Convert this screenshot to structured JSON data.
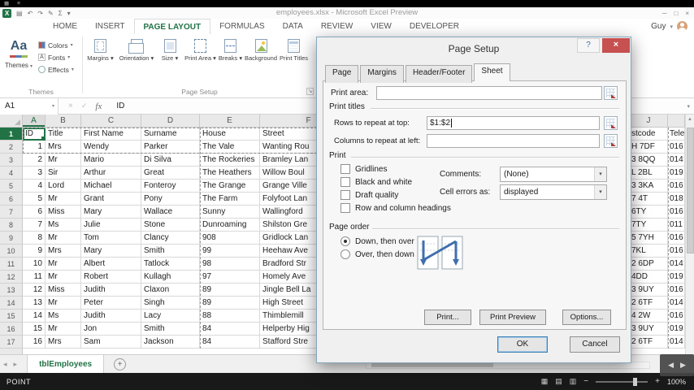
{
  "colors": {
    "accent": "#217346",
    "close_button": "#c75050"
  },
  "icons": {
    "grid": "▦",
    "menu": "≡",
    "excel_logo": "X",
    "save": "▤",
    "undo": "↶",
    "redo": "↷",
    "pencil": "✎",
    "autosum": "Σ",
    "chart": "▦",
    "qat_dropdown": "▾",
    "minimize": "─",
    "maximize": "□",
    "close": "×",
    "user_dropdown": "▾",
    "name_box_arrow": "▾",
    "cancel": "×",
    "enter": "✓",
    "fx": "fx",
    "formula_expand": "▾",
    "scroll_up": "▲",
    "tab_prev": "◂",
    "tab_next": "▸",
    "add_sheet": "+",
    "view_normal": "▦",
    "view_layout": "▤",
    "view_break": "▥",
    "zoom_out": "−",
    "zoom_in": "+",
    "nav_prev": "◀",
    "nav_next": "▶",
    "help": "?",
    "launcher": "↘",
    "combo_arrow": "▾"
  },
  "title_bar": {
    "title": "employees.xlsx - Microsoft Excel Preview"
  },
  "ribbon": {
    "tabs": [
      "HOME",
      "INSERT",
      "PAGE LAYOUT",
      "FORMULAS",
      "DATA",
      "REVIEW",
      "VIEW",
      "DEVELOPER"
    ],
    "active": "PAGE LAYOUT",
    "user_name": "Guy",
    "themes_group": {
      "label": "Themes",
      "big_button": "Themes",
      "icon_text": "Aa",
      "items": [
        "Colors",
        "Fonts",
        "Effects"
      ]
    },
    "pagesetup_group": {
      "label": "Page Setup",
      "buttons": [
        "Margins",
        "Orientation",
        "Size",
        "Print Area",
        "Breaks",
        "Background",
        "Print Titles"
      ]
    }
  },
  "formula_bar": {
    "name_box": "A1",
    "value": "ID"
  },
  "sheet": {
    "columns": [
      "A",
      "B",
      "C",
      "D",
      "E",
      "F"
    ],
    "rows": [
      [
        "ID",
        "Title",
        "First Name",
        "Surname",
        "House",
        "Street"
      ],
      [
        "1",
        "Mrs",
        "Wendy",
        "Parker",
        "The Vale",
        "Wanting Rou"
      ],
      [
        "2",
        "Mr",
        "Mario",
        "Di Silva",
        "The Rockeries",
        "Bramley Lan"
      ],
      [
        "3",
        "Sir",
        "Arthur",
        "Great",
        "The Heathers",
        "Willow Boul"
      ],
      [
        "4",
        "Lord",
        "Michael",
        "Fonteroy",
        "The Grange",
        "Grange Ville"
      ],
      [
        "5",
        "Mr",
        "Grant",
        "Pony",
        "The Farm",
        "Folyfoot Lan"
      ],
      [
        "6",
        "Miss",
        "Mary",
        "Wallace",
        "Sunny",
        "Wallingford"
      ],
      [
        "7",
        "Ms",
        "Julie",
        "Stone",
        "Dunroaming",
        "Shilston Gre"
      ],
      [
        "8",
        "Mr",
        "Tom",
        "Clancy",
        "908",
        "Gridlock Lan"
      ],
      [
        "9",
        "Mrs",
        "Mary",
        "Smith",
        "99",
        "Heehaw Ave"
      ],
      [
        "10",
        "Mr",
        "Albert",
        "Tatlock",
        "98",
        "Bradford Str"
      ],
      [
        "11",
        "Mr",
        "Robert",
        "Kullagh",
        "97",
        "Homely Ave"
      ],
      [
        "12",
        "Miss",
        "Judith",
        "Claxon",
        "89",
        "Jingle Bell La"
      ],
      [
        "13",
        "Mr",
        "Peter",
        "Singh",
        "89",
        "High Street"
      ],
      [
        "14",
        "Ms",
        "Judith",
        "Lacy",
        "88",
        "Thimblemill"
      ],
      [
        "15",
        "Mr",
        "Jon",
        "Smith",
        "84",
        "Helperby Hig"
      ],
      [
        "16",
        "Mrs",
        "Sam",
        "Jackson",
        "84",
        "Stafford Stre"
      ]
    ],
    "right": {
      "col_letter": "J",
      "headers": [
        "stcode",
        "Tele"
      ],
      "rows": [
        [
          "H 7DF",
          "016"
        ],
        [
          "3 8QQ",
          "014"
        ],
        [
          "L 2BL",
          "019"
        ],
        [
          "3 3KA",
          "016"
        ],
        [
          "7 4T",
          "018"
        ],
        [
          "6TY",
          "016"
        ],
        [
          "7TY",
          "011"
        ],
        [
          "5 7YH",
          "016"
        ],
        [
          "7KL",
          "016"
        ],
        [
          "2 6DP",
          "014"
        ],
        [
          "4DD",
          "019"
        ],
        [
          "3 9UY",
          "016"
        ],
        [
          "2 6TF",
          "014"
        ],
        [
          "4 2W",
          "016"
        ],
        [
          "3 9UY",
          "019"
        ],
        [
          "2 6TF",
          "014"
        ]
      ]
    },
    "tab_name": "tblEmployees"
  },
  "status_bar": {
    "mode": "POINT",
    "zoom_level": "100%"
  },
  "dialog": {
    "title": "Page Setup",
    "tabs": [
      "Page",
      "Margins",
      "Header/Footer",
      "Sheet"
    ],
    "active_tab": "Sheet",
    "fields": {
      "print_area": {
        "label": "Print area:",
        "value": ""
      },
      "print_titles_label": "Print titles",
      "rows_repeat": {
        "label": "Rows to repeat at top:",
        "value": "$1:$2"
      },
      "cols_repeat": {
        "label": "Columns to repeat at left:",
        "value": ""
      }
    },
    "print_section": {
      "label": "Print",
      "checkboxes": [
        {
          "label": "Gridlines",
          "checked": false
        },
        {
          "label": "Black and white",
          "checked": false
        },
        {
          "label": "Draft quality",
          "checked": false
        },
        {
          "label": "Row and column headings",
          "checked": false
        }
      ],
      "comments": {
        "label": "Comments:",
        "value": "(None)"
      },
      "cell_errors": {
        "label": "Cell errors as:",
        "value": "displayed"
      }
    },
    "page_order": {
      "label": "Page order",
      "options": [
        {
          "label": "Down, then over",
          "selected": true
        },
        {
          "label": "Over, then down",
          "selected": false
        }
      ]
    },
    "buttons": {
      "print": "Print...",
      "print_preview": "Print Preview",
      "options": "Options...",
      "ok": "OK",
      "cancel": "Cancel"
    }
  }
}
